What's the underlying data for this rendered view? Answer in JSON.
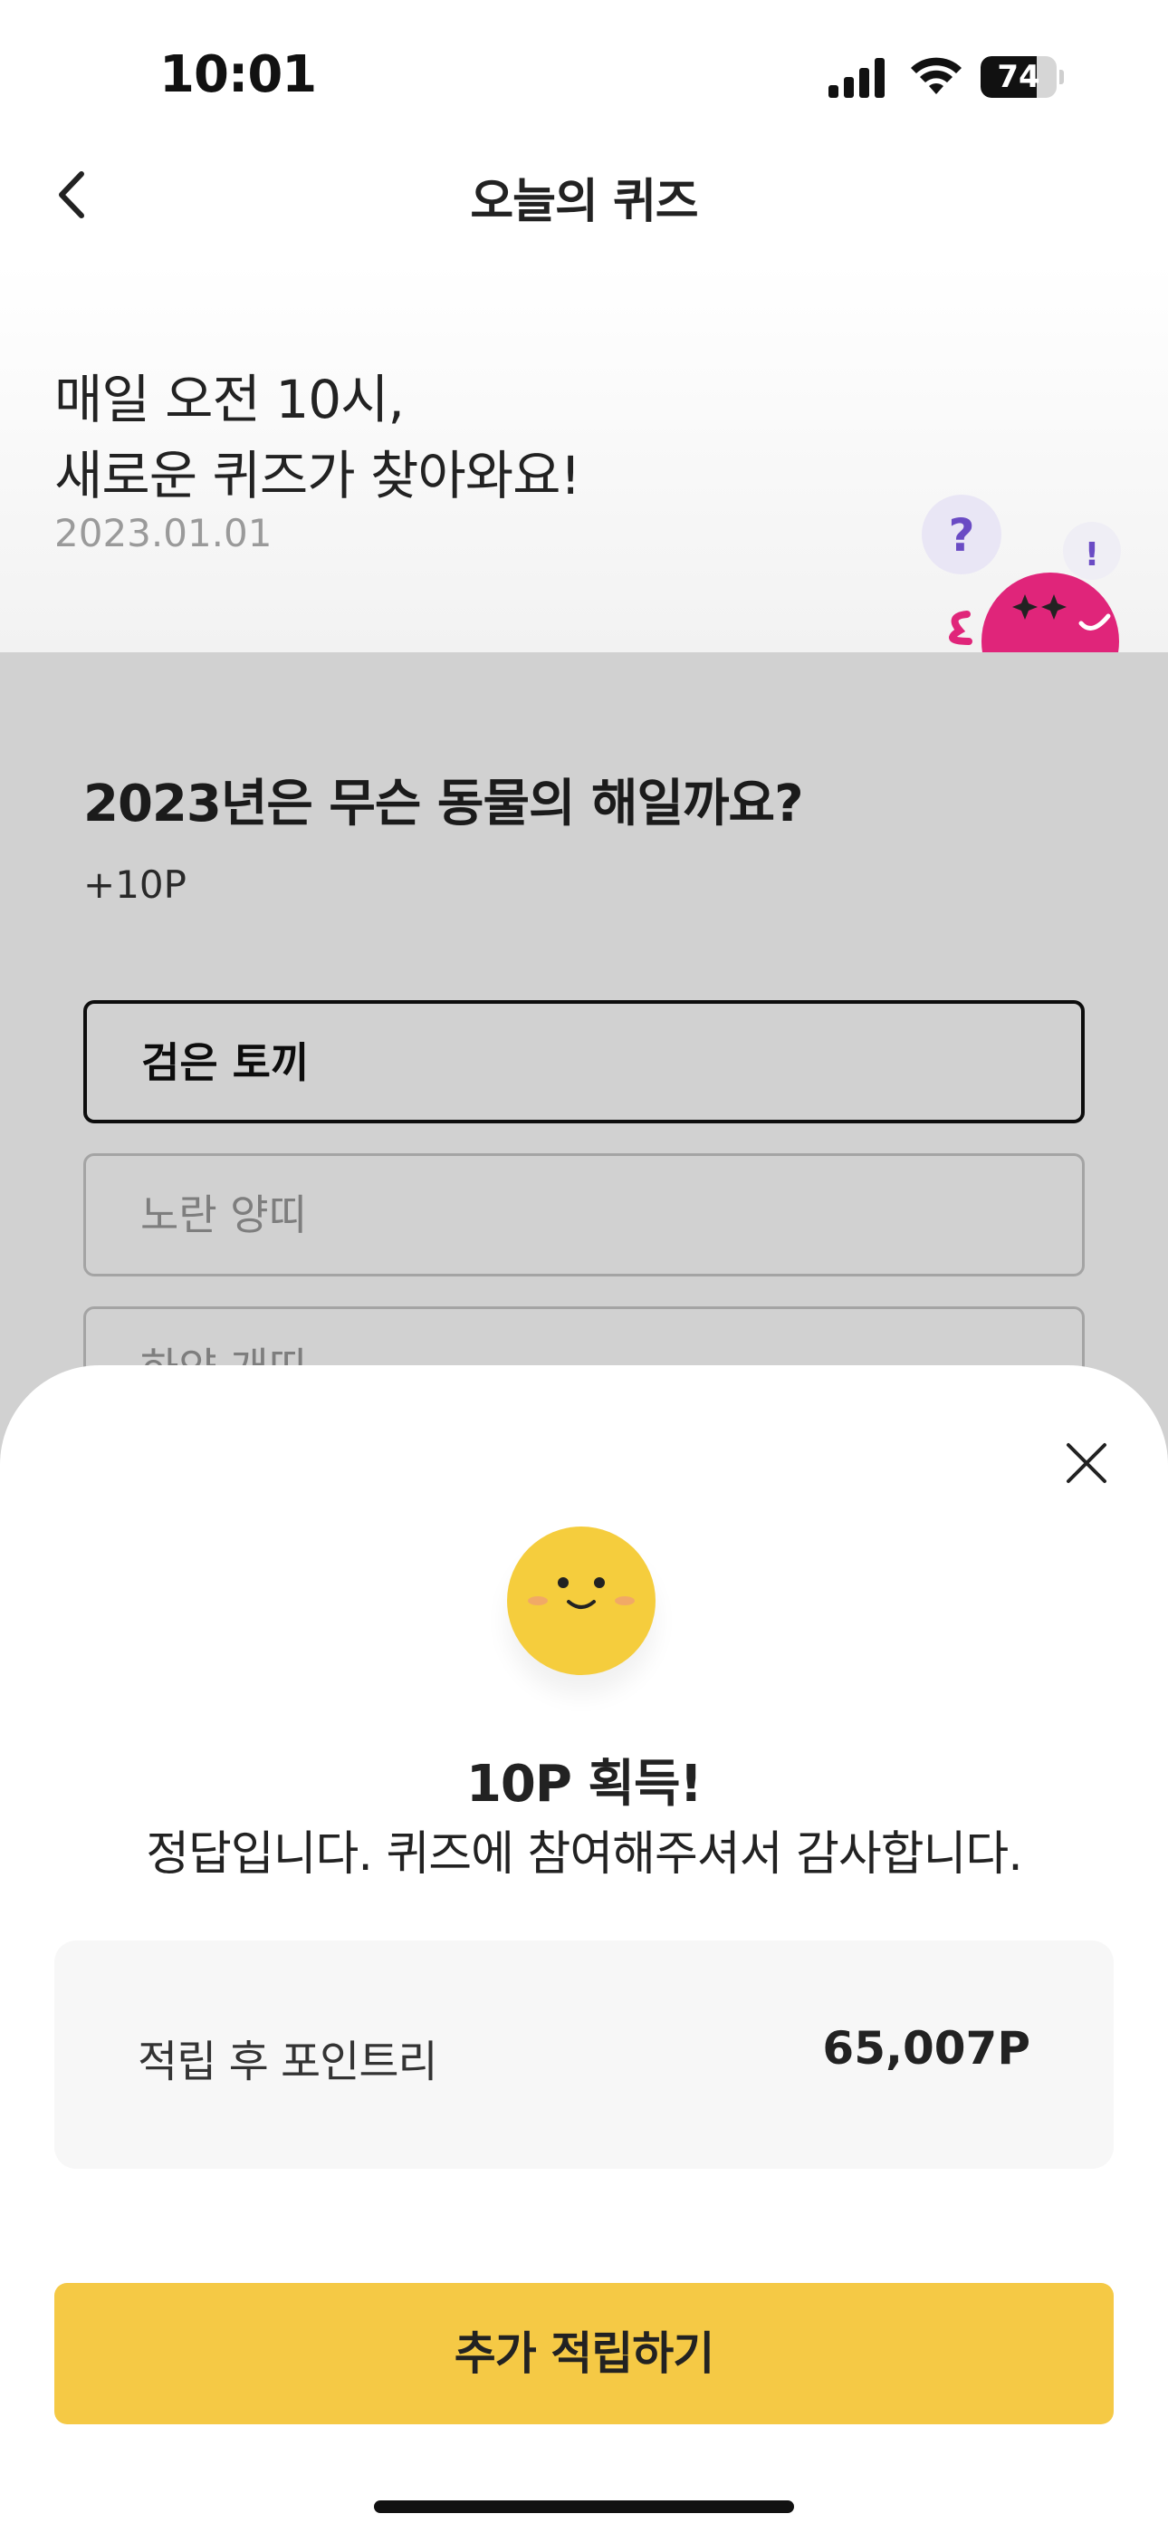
{
  "status_bar": {
    "time": "10:01",
    "battery_level": "74",
    "battery_fraction": 0.74
  },
  "header": {
    "title": "오늘의 퀴즈",
    "back_icon": "chevron-left-icon"
  },
  "hero": {
    "line1": "매일 오전 10시,",
    "line2": "새로운 퀴즈가 찾아와요!",
    "date": "2023.01.01",
    "mascot_bubble_1": "?",
    "mascot_bubble_2": "!"
  },
  "quiz": {
    "question": "2023년은 무슨 동물의 해일까요?",
    "points": "+10P",
    "options": [
      {
        "label": "검은 토끼",
        "selected": true
      },
      {
        "label": "노란 양띠",
        "selected": false
      },
      {
        "label": "하얀 개띠",
        "selected": false
      }
    ]
  },
  "result_sheet": {
    "close_icon": "close-icon",
    "emoji_icon": "smiley-face-icon",
    "title": "10P 획득!",
    "message": "정답입니다. 퀴즈에 참여해주셔서 감사합니다.",
    "point_label": "적립 후 포인트리",
    "point_value": "65,007P",
    "cta_label": "추가 적립하기"
  },
  "colors": {
    "accent_yellow": "#f5c945",
    "emoji_yellow": "#f5cd3d",
    "mascot_pink": "#e0257a",
    "bubble_purple": "#6a4bc4"
  }
}
